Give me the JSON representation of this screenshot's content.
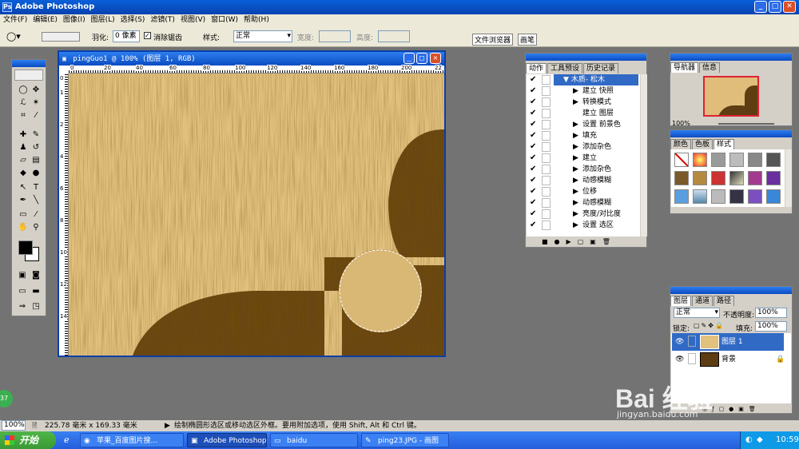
{
  "app": {
    "title": "Adobe Photoshop",
    "window_buttons": [
      "_",
      "□",
      "✕"
    ]
  },
  "menu": [
    "文件(F)",
    "编辑(E)",
    "图像(I)",
    "图层(L)",
    "选择(S)",
    "滤镜(T)",
    "视图(V)",
    "窗口(W)",
    "帮助(H)"
  ],
  "options": {
    "feather_label": "羽化:",
    "feather_value": "0 像素",
    "antialias_label": "消除锯齿",
    "style_label": "样式:",
    "style_value": "正常",
    "width_label": "宽度:",
    "height_label": "高度:",
    "right_tabs": [
      "文件浏览器",
      "画笔"
    ]
  },
  "document": {
    "title": "pingGuo1 @ 100% (图层 1, RGB)",
    "ruler_labels": [
      "0",
      "20",
      "40",
      "60",
      "80",
      "100",
      "120",
      "140",
      "160",
      "180",
      "200",
      "22"
    ],
    "vruler_labels": [
      "0",
      "1",
      "2",
      "4",
      "6",
      "8",
      "10",
      "12",
      "14"
    ]
  },
  "actions_panel": {
    "tabs": [
      "动作",
      "工具预设",
      "历史记录"
    ],
    "items": [
      {
        "label": "木质- 松木",
        "selected": true
      },
      {
        "label": "建立 快照"
      },
      {
        "label": "转换模式"
      },
      {
        "label": "建立 图层"
      },
      {
        "label": "设置 前景色"
      },
      {
        "label": "填充"
      },
      {
        "label": "添加杂色"
      },
      {
        "label": "建立"
      },
      {
        "label": "添加杂色"
      },
      {
        "label": "动感模糊"
      },
      {
        "label": "位移"
      },
      {
        "label": "动感模糊"
      },
      {
        "label": "亮度/对比度"
      },
      {
        "label": "设置 选区"
      }
    ]
  },
  "navigator": {
    "tabs": [
      "导航器",
      "信息"
    ],
    "zoom": "100%"
  },
  "swatches": {
    "tabs": [
      "颜色",
      "色板",
      "样式"
    ]
  },
  "layers": {
    "tabs": [
      "图层",
      "通道",
      "路径"
    ],
    "blend_mode": "正常",
    "opacity_label": "不透明度:",
    "opacity_value": "100%",
    "lock_label": "锁定:",
    "fill_label": "填充:",
    "fill_value": "100%",
    "items": [
      {
        "name": "图层 1",
        "selected": true
      },
      {
        "name": "背景",
        "locked": true
      }
    ]
  },
  "status": {
    "zoom": "100%",
    "doc_size": "225.78 毫米 x 169.33 毫米",
    "hint": "绘制椭圆形选区或移动选区外框。要用附加选项，使用 Shift, Alt 和 Ctrl 键。"
  },
  "taskbar": {
    "start": "开始",
    "tasks": [
      "苹果_百度图片搜...",
      "Adobe Photoshop",
      "baidu",
      "ping23.JPG - 画图"
    ],
    "clock": "10:59"
  },
  "watermark": {
    "brand": "Bai 经验",
    "url": "jingyan.baidu.com"
  },
  "badge": "37",
  "colors": {
    "wood_light": "#e2c07e",
    "wood_dark": "#5a3a10",
    "titlebar": "#0842b0"
  }
}
